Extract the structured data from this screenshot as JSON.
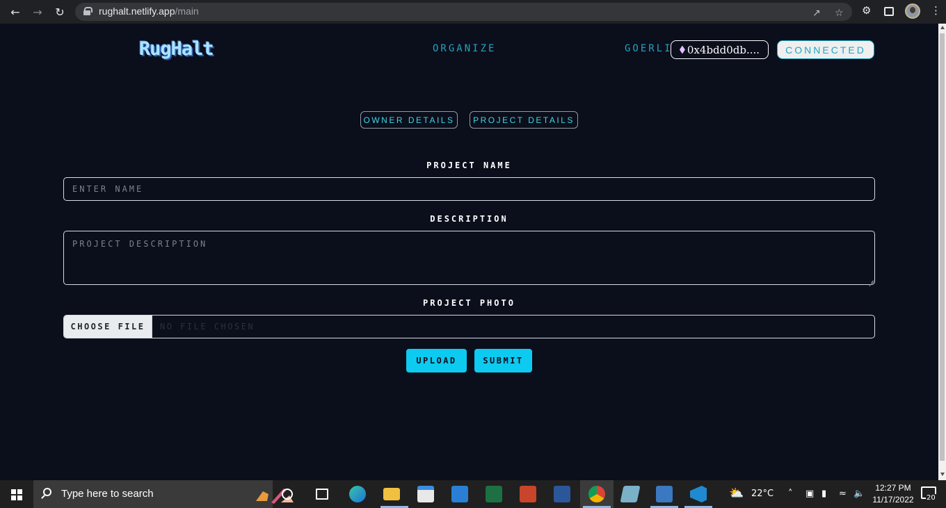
{
  "browser": {
    "url_host": "rughalt.netlify.app",
    "url_path": "/main"
  },
  "header": {
    "logo": "RugHalt",
    "nav_organize": "ORGANIZE",
    "network": "GOERLI",
    "wallet_address": "0x4bdd0db....",
    "status": "CONNECTED"
  },
  "tabs": {
    "owner": "OWNER DETAILS",
    "project": "PROJECT DETAILS"
  },
  "form": {
    "project_name_label": "PROJECT NAME",
    "project_name_placeholder": "ENTER NAME",
    "description_label": "DESCRIPTION",
    "description_placeholder": "PROJECT DESCRIPTION",
    "photo_label": "PROJECT PHOTO",
    "choose_file": "CHOOSE FILE",
    "no_file": "NO FILE CHOSEN",
    "upload": "UPLOAD",
    "submit": "SUBMIT"
  },
  "taskbar": {
    "search_placeholder": "Type here to search",
    "weather": "22°C",
    "time": "12:27 PM",
    "date": "11/17/2022",
    "notifications": "20"
  },
  "colors": {
    "page_bg": "#0b0e1b",
    "accent_cyan": "#0dcaf0",
    "nav_blue": "#1fa5c4",
    "tab_text": "#3fd6e6"
  }
}
